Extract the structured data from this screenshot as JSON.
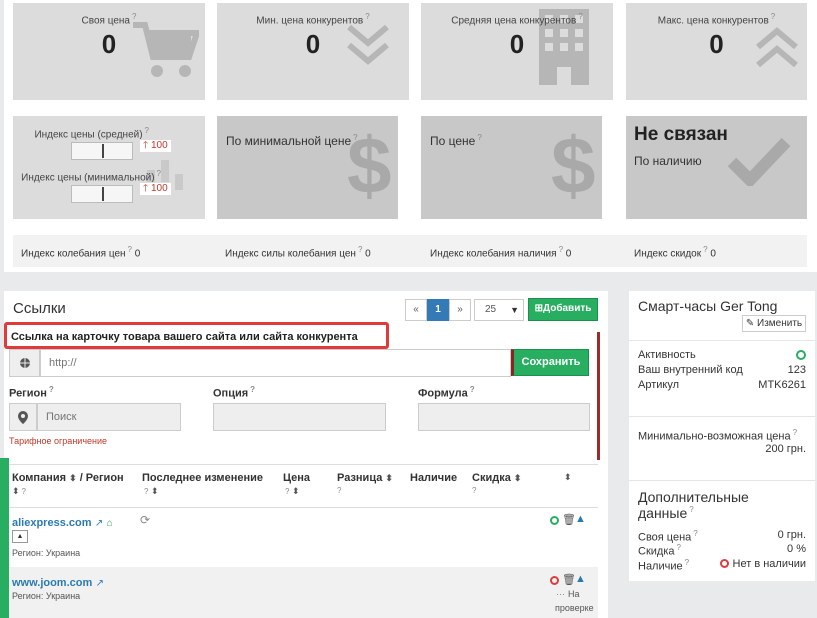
{
  "stats": {
    "own_price": {
      "label": "Своя цена",
      "value": "0"
    },
    "min_price": {
      "label": "Мин. цена конкурентов",
      "value": "0"
    },
    "avg_price": {
      "label": "Средняя цена конкурентов",
      "value": "0"
    },
    "max_price": {
      "label": "Макс. цена конкурентов",
      "value": "0"
    }
  },
  "price_index": {
    "avg_label": "Индекс цены (средней)",
    "avg_badge": "100",
    "min_label": "Индекс цены (минимальной)",
    "min_badge": "100"
  },
  "tiles": {
    "by_min_price": "По минимальной цене",
    "by_price": "По цене",
    "not_linked_title": "Не связан",
    "by_availability": "По наличию"
  },
  "indices": {
    "price_fluct": {
      "label": "Индекс колебания цен",
      "value": "0"
    },
    "price_fluct_strength": {
      "label": "Индекс силы колебания цен",
      "value": "0"
    },
    "availability_fluct": {
      "label": "Индекс колебания наличия",
      "value": "0"
    },
    "discount": {
      "label": "Индекс скидок",
      "value": "0"
    }
  },
  "links": {
    "title": "Ссылки",
    "pager": {
      "prev": "«",
      "page": "1",
      "next": "»",
      "per_page": "25"
    },
    "add_button": "Добавить",
    "hint": "Ссылка на карточку товара вашего сайта или сайта конкурента",
    "url_placeholder": "http://",
    "save_button": "Сохранить",
    "region_label": "Регион",
    "region_placeholder": "Поиск",
    "option_label": "Опция",
    "formula_label": "Формула",
    "tariff_limit": "Тарифное ограничение",
    "columns": {
      "company": "Компания",
      "region": "/ Регион",
      "last_change": "Последнее изменение",
      "price": "Цена",
      "diff": "Разница",
      "availability": "Наличие",
      "discount": "Скидка"
    },
    "rows": [
      {
        "name": "aliexpress.com",
        "region": "Регион: Украина",
        "status": ""
      },
      {
        "name": "www.joom.com",
        "region": "Регион: Украина",
        "status_line1": "На",
        "status_line2": "проверке"
      }
    ]
  },
  "product": {
    "title": "Смарт-часы Ger Tong",
    "edit_button": "Изменить",
    "active_label": "Активность",
    "internal_code_label": "Ваш внутренний код",
    "internal_code_value": "123",
    "article_label": "Артикул",
    "article_value": "MTK6261",
    "min_possible_label": "Минимально-возможная цена",
    "min_possible_value": "200 грн.",
    "extra_title_1": "Дополнительные",
    "extra_title_2": "данные",
    "own_price_label": "Своя цена",
    "own_price_value": "0 грн.",
    "discount_label": "Скидка",
    "discount_value": "0 %",
    "availability_label": "Наличие",
    "availability_value": "Нет в наличии"
  },
  "colors": {
    "accent_green": "#27ae60",
    "accent_blue": "#2a7ab0",
    "alert_red": "#e03b3b",
    "page_blue": "#337ab7"
  }
}
